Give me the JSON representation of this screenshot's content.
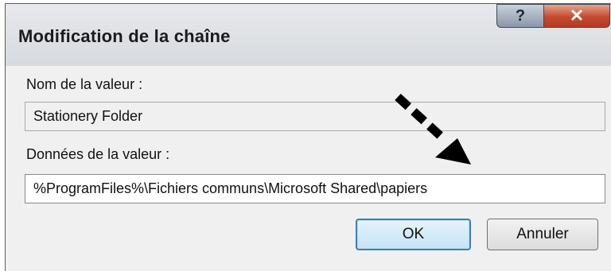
{
  "dialog": {
    "title": "Modification de la chaîne",
    "help_icon": "help-icon",
    "close_icon": "close-icon"
  },
  "value_name": {
    "label": "Nom de la valeur :",
    "value": "Stationery Folder"
  },
  "value_data": {
    "label": "Données de la valeur :",
    "value": "%ProgramFiles%\\Fichiers communs\\Microsoft Shared\\papiers"
  },
  "buttons": {
    "ok": "OK",
    "cancel": "Annuler"
  },
  "annotation": {
    "icon": "dashed-arrow-icon",
    "color": "#000000"
  }
}
